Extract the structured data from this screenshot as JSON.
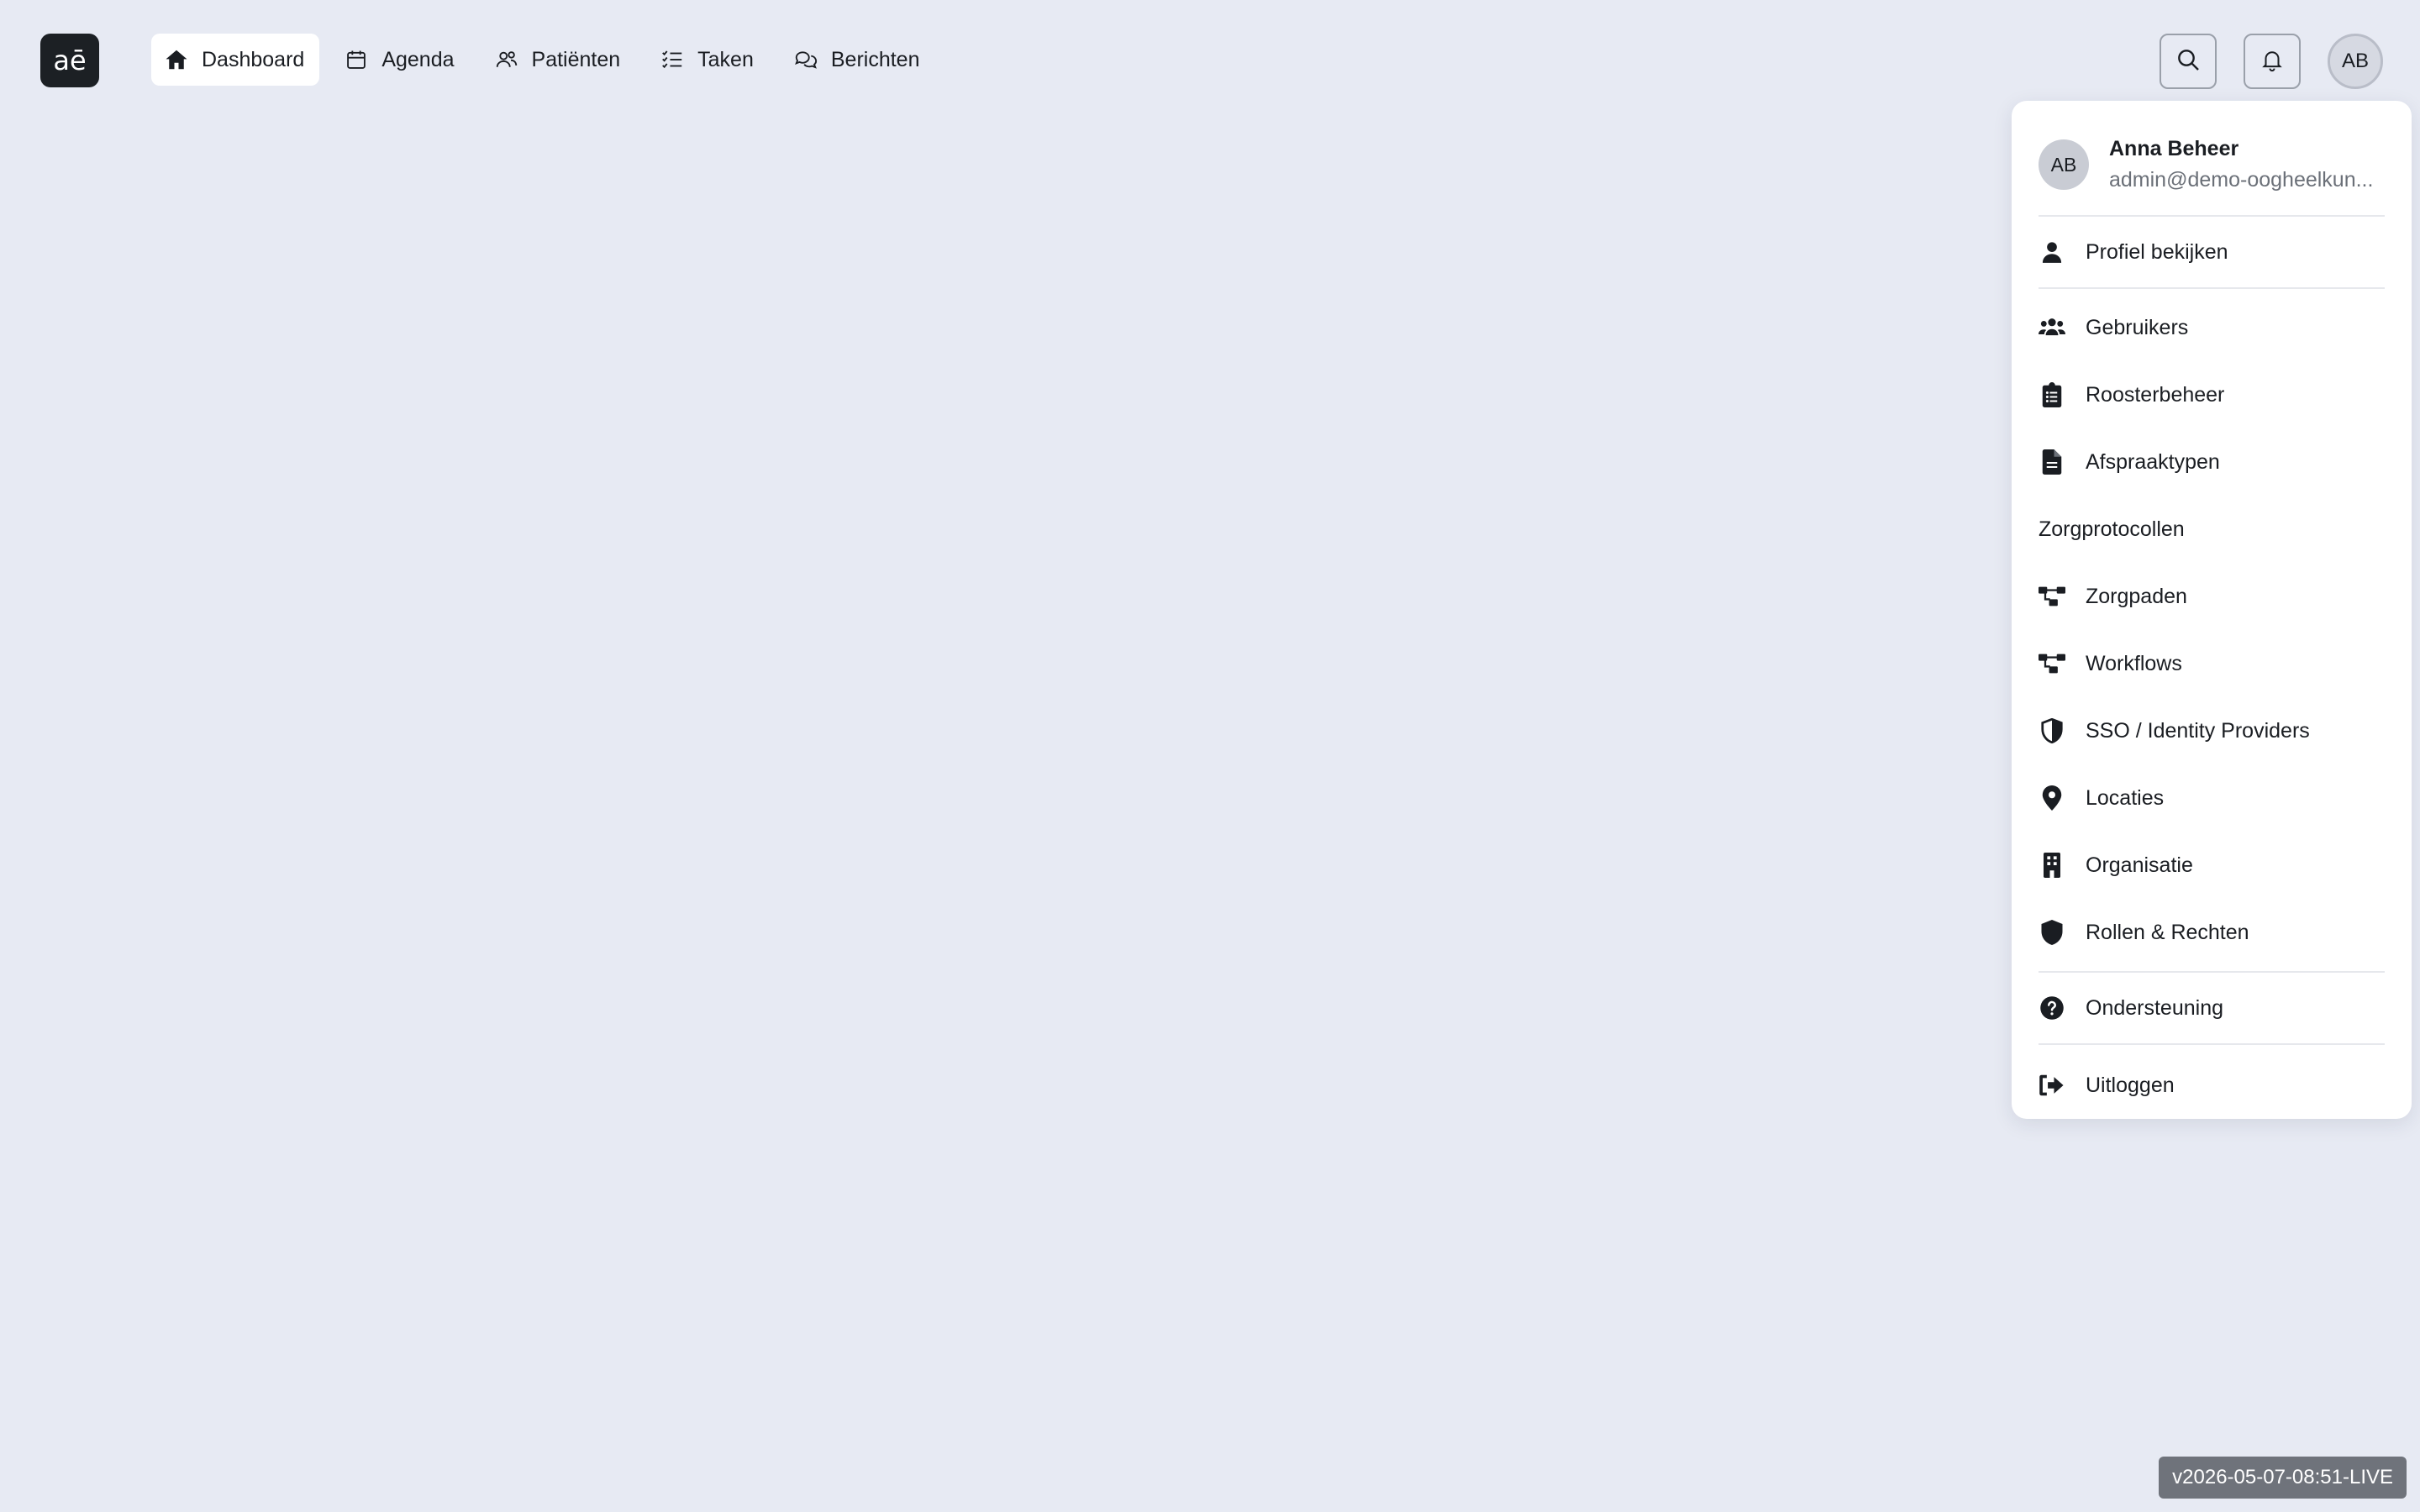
{
  "app": {
    "logo_text": "aē"
  },
  "nav": {
    "items": [
      {
        "label": "Dashboard",
        "icon": "home-icon",
        "active": true
      },
      {
        "label": "Agenda",
        "icon": "calendar-icon"
      },
      {
        "label": "Patiënten",
        "icon": "users-icon"
      },
      {
        "label": "Taken",
        "icon": "checklist-icon"
      },
      {
        "label": "Berichten",
        "icon": "chat-icon"
      }
    ]
  },
  "top_actions": {
    "search_icon": "search-icon",
    "notifications_icon": "bell-icon",
    "avatar_initials": "AB"
  },
  "user_menu": {
    "avatar_initials": "AB",
    "name": "Anna Beheer",
    "email": "admin@demo-oogheelkun...",
    "profile_label": "Profiel bekijken",
    "admin_items": [
      {
        "label": "Gebruikers",
        "icon": "user-group-icon"
      },
      {
        "label": "Roosterbeheer",
        "icon": "clipboard-list-icon"
      },
      {
        "label": "Afspraaktypen",
        "icon": "file-text-icon"
      }
    ],
    "section_label": "Zorgprotocollen",
    "protocol_items": [
      {
        "label": "Zorgpaden",
        "icon": "flow-icon"
      },
      {
        "label": "Workflows",
        "icon": "flow-icon"
      },
      {
        "label": "SSO / Identity Providers",
        "icon": "half-shield-icon"
      },
      {
        "label": "Locaties",
        "icon": "map-pin-icon"
      },
      {
        "label": "Organisatie",
        "icon": "building-icon"
      },
      {
        "label": "Rollen & Rechten",
        "icon": "shield-icon"
      }
    ],
    "support_label": "Ondersteuning",
    "logout_label": "Uitloggen"
  },
  "version": "v2026-05-07-08:51-LIVE"
}
